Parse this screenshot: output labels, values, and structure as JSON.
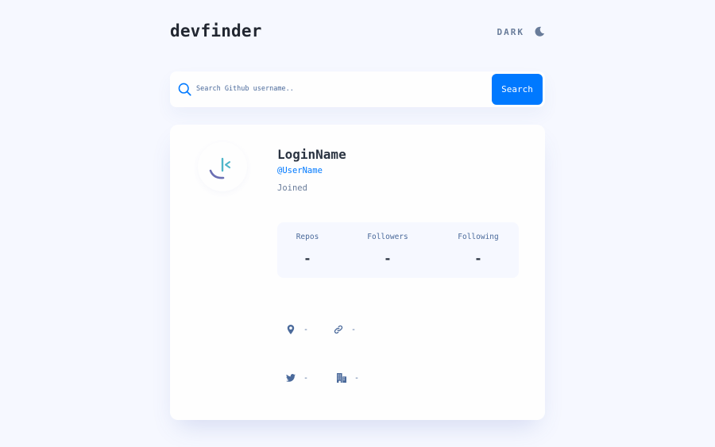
{
  "header": {
    "logo": "devfinder",
    "theme_label": "DARK",
    "theme_icon": "moon-icon"
  },
  "search": {
    "placeholder": "Search Github username..",
    "value": "",
    "button_label": "Search",
    "icon": "search-icon"
  },
  "profile": {
    "login_name": "LoginName",
    "handle": "@UserName",
    "joined": "Joined",
    "avatar_icon": "loading-spinner-icon"
  },
  "stats": [
    {
      "label": "Repos",
      "value": "-"
    },
    {
      "label": "Followers",
      "value": "-"
    },
    {
      "label": "Following",
      "value": "-"
    }
  ],
  "links": {
    "location": {
      "icon": "location-pin-icon",
      "text": "-"
    },
    "blog": {
      "icon": "link-icon",
      "text": "-"
    },
    "twitter": {
      "icon": "twitter-icon",
      "text": "-"
    },
    "company": {
      "icon": "building-icon",
      "text": "-"
    }
  },
  "colors": {
    "background": "#f6f8ff",
    "card": "#fefefe",
    "accent": "#0079ff",
    "text_dark": "#2b3442",
    "text_muted": "#4b6a9b"
  }
}
